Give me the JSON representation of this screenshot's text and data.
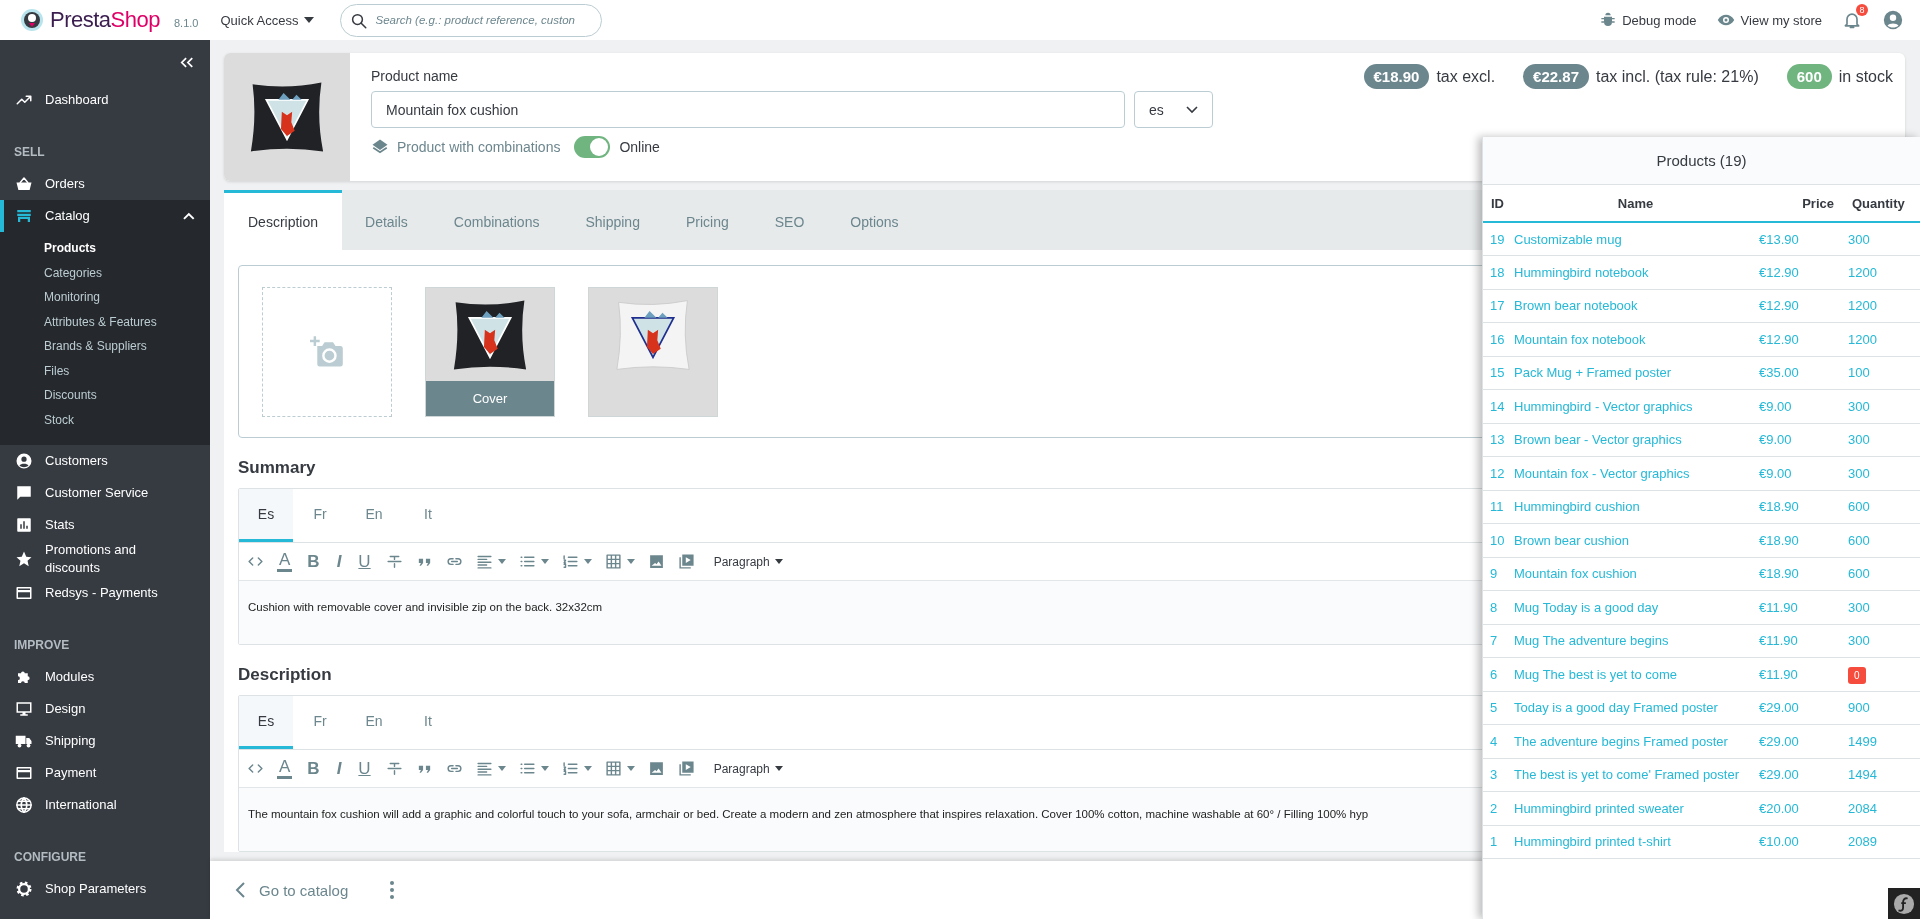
{
  "header": {
    "logo": {
      "parts": [
        "Presta",
        "Shop"
      ]
    },
    "version": "8.1.0",
    "quick_access": "Quick Access",
    "search": {
      "placeholder": "Search (e.g.: product reference, custon"
    },
    "debug_mode": "Debug mode",
    "view_store": "View my store",
    "notifications": "8"
  },
  "sidebar": {
    "items": [
      {
        "kind": "link",
        "label": "Dashboard",
        "selected": false
      },
      {
        "kind": "section",
        "label": "SELL"
      },
      {
        "kind": "link",
        "label": "Orders",
        "selected": false
      },
      {
        "kind": "link",
        "label": "Catalog",
        "selected": true,
        "expanded": true,
        "children": [
          {
            "label": "Products",
            "selected": true
          },
          {
            "label": "Categories",
            "selected": false
          },
          {
            "label": "Monitoring",
            "selected": false
          },
          {
            "label": "Attributes & Features",
            "selected": false
          },
          {
            "label": "Brands & Suppliers",
            "selected": false
          },
          {
            "label": "Files",
            "selected": false
          },
          {
            "label": "Discounts",
            "selected": false
          },
          {
            "label": "Stock",
            "selected": false
          }
        ]
      },
      {
        "kind": "link",
        "label": "Customers",
        "selected": false
      },
      {
        "kind": "link",
        "label": "Customer Service",
        "selected": false
      },
      {
        "kind": "link",
        "label": "Stats",
        "selected": false
      },
      {
        "kind": "link",
        "label": "Promotions and discounts",
        "selected": false
      },
      {
        "kind": "link",
        "label": "Redsys - Payments",
        "selected": false
      },
      {
        "kind": "section",
        "label": "IMPROVE"
      },
      {
        "kind": "link",
        "label": "Modules",
        "selected": false
      },
      {
        "kind": "link",
        "label": "Design",
        "selected": false
      },
      {
        "kind": "link",
        "label": "Shipping",
        "selected": false
      },
      {
        "kind": "link",
        "label": "Payment",
        "selected": false
      },
      {
        "kind": "link",
        "label": "International",
        "selected": false
      },
      {
        "kind": "section",
        "label": "CONFIGURE"
      },
      {
        "kind": "link",
        "label": "Shop Parameters",
        "selected": false
      }
    ]
  },
  "product": {
    "name_label": "Product name",
    "name": "Mountain fox cushion",
    "language": "es",
    "combinations": "Product with combinations",
    "online": true,
    "online_label": "Online",
    "badges": [
      {
        "value": "€18.90",
        "label": "tax excl.",
        "color": "#6c868e"
      },
      {
        "value": "€22.87",
        "label": "tax incl. (tax rule: 21%)",
        "color": "#6c868e"
      },
      {
        "value": "600",
        "label": "in stock",
        "color": "#70b580"
      }
    ]
  },
  "tabs": [
    {
      "label": "Description",
      "selected": true
    },
    {
      "label": "Details",
      "selected": false
    },
    {
      "label": "Combinations",
      "selected": false
    },
    {
      "label": "Shipping",
      "selected": false
    },
    {
      "label": "Pricing",
      "selected": false
    },
    {
      "label": "SEO",
      "selected": false
    },
    {
      "label": "Options",
      "selected": false
    }
  ],
  "images": [
    {
      "kind": "dark",
      "cover": true,
      "caption": "Cover"
    },
    {
      "kind": "light",
      "cover": false
    }
  ],
  "editors": [
    {
      "heading": "Summary",
      "languages": [
        {
          "label": "Es",
          "selected": true
        },
        {
          "label": "Fr",
          "selected": false
        },
        {
          "label": "En",
          "selected": false
        },
        {
          "label": "It",
          "selected": false
        }
      ],
      "toolbar": [
        {
          "kind": "icon",
          "menu": false
        },
        {
          "kind": "glyph",
          "text": "A"
        },
        {
          "kind": "glyph",
          "text": "B"
        },
        {
          "kind": "glyph",
          "text": "I"
        },
        {
          "kind": "glyph",
          "text": "U"
        },
        {
          "kind": "icon",
          "menu": false
        },
        {
          "kind": "icon",
          "menu": false
        },
        {
          "kind": "icon",
          "menu": false
        },
        {
          "kind": "icon",
          "menu": true
        },
        {
          "kind": "icon",
          "menu": true
        },
        {
          "kind": "icon",
          "menu": true
        },
        {
          "kind": "icon",
          "menu": true
        },
        {
          "kind": "icon",
          "menu": false
        },
        {
          "kind": "icon",
          "menu": false
        },
        {
          "kind": "dropdown",
          "text": "Paragraph"
        }
      ],
      "content": "Cushion with removable cover and invisible zip on the back. 32x32cm"
    },
    {
      "heading": "Description",
      "languages": [
        {
          "label": "Es",
          "selected": true
        },
        {
          "label": "Fr",
          "selected": false
        },
        {
          "label": "En",
          "selected": false
        },
        {
          "label": "It",
          "selected": false
        }
      ],
      "toolbar": [
        {
          "kind": "icon",
          "menu": false
        },
        {
          "kind": "glyph",
          "text": "A"
        },
        {
          "kind": "glyph",
          "text": "B"
        },
        {
          "kind": "glyph",
          "text": "I"
        },
        {
          "kind": "glyph",
          "text": "U"
        },
        {
          "kind": "icon",
          "menu": false
        },
        {
          "kind": "icon",
          "menu": false
        },
        {
          "kind": "icon",
          "menu": false
        },
        {
          "kind": "icon",
          "menu": true
        },
        {
          "kind": "icon",
          "menu": true
        },
        {
          "kind": "icon",
          "menu": true
        },
        {
          "kind": "icon",
          "menu": true
        },
        {
          "kind": "icon",
          "menu": false
        },
        {
          "kind": "icon",
          "menu": false
        },
        {
          "kind": "dropdown",
          "text": "Paragraph"
        }
      ],
      "content": "The mountain fox cushion will add a graphic and colorful touch to your sofa, armchair or bed. Create a modern and zen atmosphere that inspires relaxation. Cover 100% cotton, machine washable at 60° / Filling 100% hyp"
    }
  ],
  "footer": {
    "back": "Go to catalog"
  },
  "products_panel": {
    "title": "Products (19)",
    "columns": [
      "ID",
      "Name",
      "Price",
      "Quantity"
    ],
    "rows": [
      {
        "id": "19",
        "name": "Customizable mug",
        "price": "€13.90",
        "quantity": "300",
        "out_of_stock": false
      },
      {
        "id": "18",
        "name": "Hummingbird notebook",
        "price": "€12.90",
        "quantity": "1200",
        "out_of_stock": false
      },
      {
        "id": "17",
        "name": "Brown bear notebook",
        "price": "€12.90",
        "quantity": "1200",
        "out_of_stock": false
      },
      {
        "id": "16",
        "name": "Mountain fox notebook",
        "price": "€12.90",
        "quantity": "1200",
        "out_of_stock": false
      },
      {
        "id": "15",
        "name": "Pack Mug + Framed poster",
        "price": "€35.00",
        "quantity": "100",
        "out_of_stock": false
      },
      {
        "id": "14",
        "name": "Hummingbird - Vector graphics",
        "price": "€9.00",
        "quantity": "300",
        "out_of_stock": false
      },
      {
        "id": "13",
        "name": "Brown bear - Vector graphics",
        "price": "€9.00",
        "quantity": "300",
        "out_of_stock": false
      },
      {
        "id": "12",
        "name": "Mountain fox - Vector graphics",
        "price": "€9.00",
        "quantity": "300",
        "out_of_stock": false
      },
      {
        "id": "11",
        "name": "Hummingbird cushion",
        "price": "€18.90",
        "quantity": "600",
        "out_of_stock": false
      },
      {
        "id": "10",
        "name": "Brown bear cushion",
        "price": "€18.90",
        "quantity": "600",
        "out_of_stock": false
      },
      {
        "id": "9",
        "name": "Mountain fox cushion",
        "price": "€18.90",
        "quantity": "600",
        "out_of_stock": false
      },
      {
        "id": "8",
        "name": "Mug Today is a good day",
        "price": "€11.90",
        "quantity": "300",
        "out_of_stock": false
      },
      {
        "id": "7",
        "name": "Mug The adventure begins",
        "price": "€11.90",
        "quantity": "300",
        "out_of_stock": false
      },
      {
        "id": "6",
        "name": "Mug The best is yet to come",
        "price": "€11.90",
        "quantity": "0",
        "out_of_stock": true
      },
      {
        "id": "5",
        "name": "Today is a good day Framed poster",
        "price": "€29.00",
        "quantity": "900",
        "out_of_stock": false
      },
      {
        "id": "4",
        "name": "The adventure begins Framed poster",
        "price": "€29.00",
        "quantity": "1499",
        "out_of_stock": false
      },
      {
        "id": "3",
        "name": "The best is yet to come' Framed poster",
        "price": "€29.00",
        "quantity": "1494",
        "out_of_stock": false
      },
      {
        "id": "2",
        "name": "Hummingbird printed sweater",
        "price": "€20.00",
        "quantity": "2084",
        "out_of_stock": false
      },
      {
        "id": "1",
        "name": "Hummingbird printed t-shirt",
        "price": "€10.00",
        "quantity": "2089",
        "out_of_stock": false
      }
    ]
  }
}
